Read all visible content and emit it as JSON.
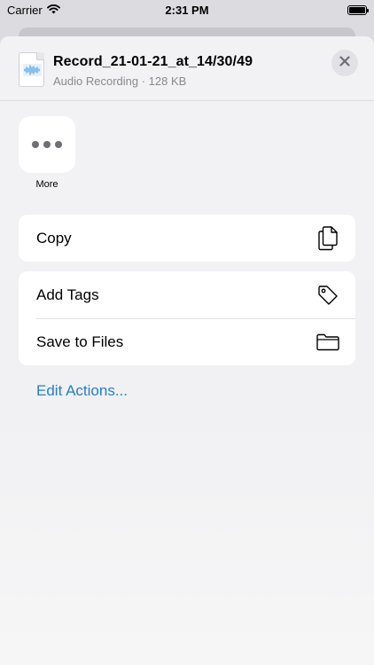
{
  "status_bar": {
    "carrier": "Carrier",
    "time": "2:31 PM"
  },
  "share_sheet": {
    "file_name": "Record_21-01-21_at_14/30/49",
    "file_type": "Audio Recording",
    "file_size": "128 KB",
    "subtitle": "Audio Recording · 128 KB"
  },
  "apps": [
    {
      "label": "More",
      "icon": "more-dots-icon"
    }
  ],
  "actions": {
    "group1": [
      {
        "label": "Copy",
        "icon": "copy-documents-icon"
      }
    ],
    "group2": [
      {
        "label": "Add Tags",
        "icon": "tag-icon"
      },
      {
        "label": "Save to Files",
        "icon": "folder-icon"
      }
    ]
  },
  "edit_actions_label": "Edit Actions...",
  "colors": {
    "accent": "#1f7fd4",
    "sheet_background": "#f2f2f4",
    "secondary_text": "#8a8a8e"
  }
}
